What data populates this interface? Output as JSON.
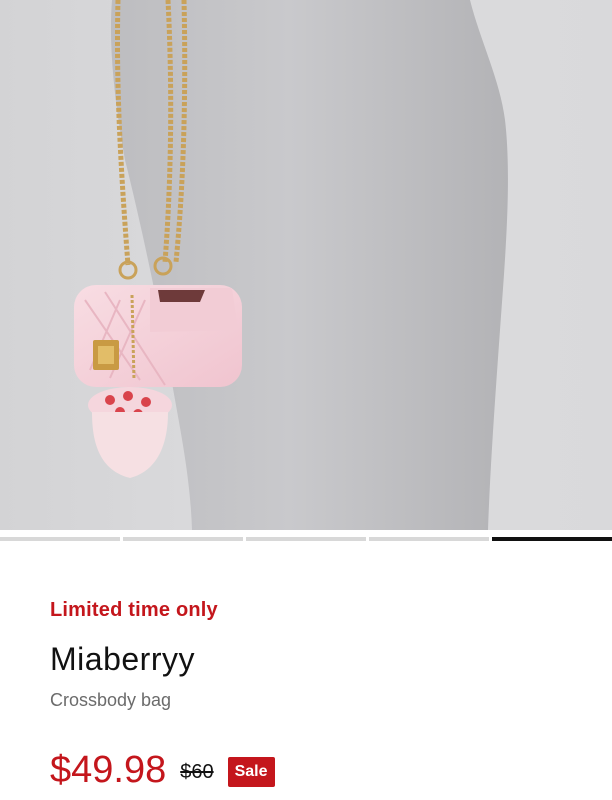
{
  "product": {
    "image_name": "pink-quilted-mini-bag-on-mannequin",
    "carousel": {
      "total": 5,
      "active_index": 5
    },
    "promo_label": "Limited time only",
    "name": "Miaberryy",
    "category": "Crossbody bag",
    "price_now": "$49.98",
    "price_was": "$60",
    "sale_badge": "Sale"
  },
  "colors": {
    "sale_red": "#c4161c",
    "text_dark": "#111111",
    "text_muted": "#6b6b6b"
  }
}
